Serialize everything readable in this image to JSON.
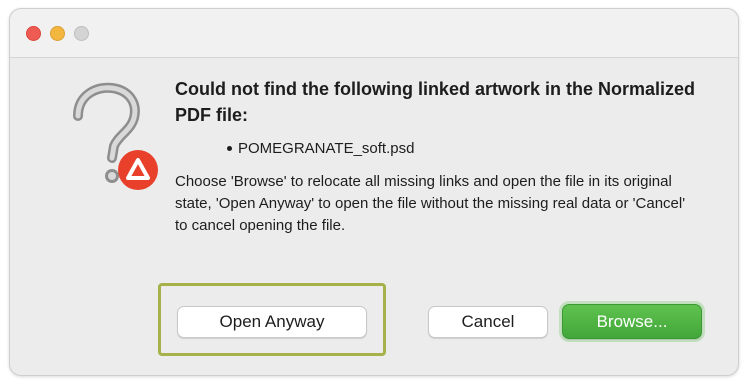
{
  "dialog": {
    "heading": "Could not find the following linked artwork in the Normalized PDF file:",
    "missing_file": "POMEGRANATE_soft.psd",
    "message": "Choose 'Browse' to relocate all missing links and open the file in its original state, 'Open Anyway' to open the file without the missing real data or 'Cancel' to cancel opening the file."
  },
  "buttons": {
    "open_anyway": "Open Anyway",
    "cancel": "Cancel",
    "browse": "Browse..."
  },
  "colors": {
    "close": "#ee5b52",
    "minimize": "#f3b73f",
    "zoom": "#c8c8c8",
    "primary": "#4cb142",
    "highlight": "#a7b14a",
    "badge": "#e8402a"
  },
  "icons": {
    "alert": "question-mark-icon",
    "badge": "adobe-warning-badge-icon"
  }
}
